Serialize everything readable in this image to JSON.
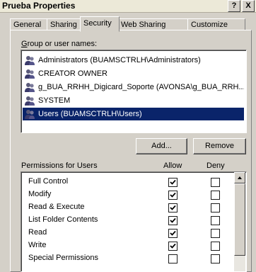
{
  "window": {
    "title": "Prueba Properties",
    "help_button": "?",
    "close_button": "X"
  },
  "tabs": [
    {
      "label": "General"
    },
    {
      "label": "Sharing"
    },
    {
      "label": "Security"
    },
    {
      "label": "Web Sharing"
    },
    {
      "label": "Customize"
    }
  ],
  "active_tab": "Security",
  "users_section": {
    "label": "Group or user names:",
    "items": [
      {
        "name": "Administrators (BUAMSCTRLH\\Administrators)",
        "selected": false
      },
      {
        "name": "CREATOR OWNER",
        "selected": false
      },
      {
        "name": "g_BUA_RRHH_Digicard_Soporte (AVONSA\\g_BUA_RRH...",
        "selected": false
      },
      {
        "name": "SYSTEM",
        "selected": false
      },
      {
        "name": "Users (BUAMSCTRLH\\Users)",
        "selected": true
      }
    ]
  },
  "buttons": {
    "add": "Add...",
    "remove": "Remove"
  },
  "permissions": {
    "title": "Permissions for Users",
    "allow_header": "Allow",
    "deny_header": "Deny",
    "rows": [
      {
        "name": "Full Control",
        "allow": true,
        "deny": false
      },
      {
        "name": "Modify",
        "allow": true,
        "deny": false
      },
      {
        "name": "Read & Execute",
        "allow": true,
        "deny": false
      },
      {
        "name": "List Folder Contents",
        "allow": true,
        "deny": false
      },
      {
        "name": "Read",
        "allow": true,
        "deny": false
      },
      {
        "name": "Write",
        "allow": true,
        "deny": false
      },
      {
        "name": "Special Permissions",
        "allow": false,
        "deny": false
      }
    ]
  }
}
